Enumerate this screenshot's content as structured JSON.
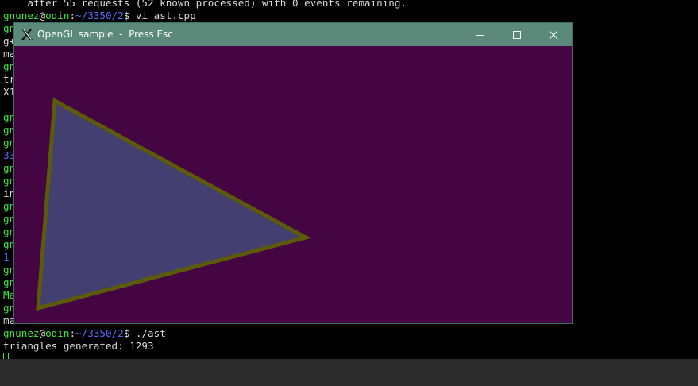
{
  "terminal": {
    "line_top": "    after 55 requests (52 known processed) with 0 events remaining.",
    "prompt_user": "gnunez",
    "prompt_at": "@",
    "prompt_host": "odin",
    "prompt_colon": ":",
    "prompt_path": "~/3350/2",
    "prompt_dollar": "$ ",
    "cmd_vi": "vi ast.cpp",
    "cmd_run": "./ast",
    "output_line": "triangles generated: 1293",
    "left_fragments": [
      "gn",
      "g+",
      "ma",
      "gn",
      "tr",
      "X1",
      "",
      "gn",
      "gn",
      "gn",
      "33",
      "gn",
      "gn",
      "in",
      "gn",
      "gn",
      "gn",
      "gn",
      "1",
      "gn",
      "gn",
      "Ma",
      "gn",
      "ma"
    ]
  },
  "window": {
    "title": "OpenGL sample  -  Press Esc",
    "icon": "x11-app-icon",
    "controls": {
      "minimize_icon": "minimize-icon",
      "maximize_icon": "maximize-icon",
      "close_icon": "close-icon"
    },
    "colors": {
      "background": "#450442",
      "triangle_fill": "#433f70",
      "triangle_outline": "#5c5b07",
      "titlebar": "#5b8a7b"
    }
  }
}
